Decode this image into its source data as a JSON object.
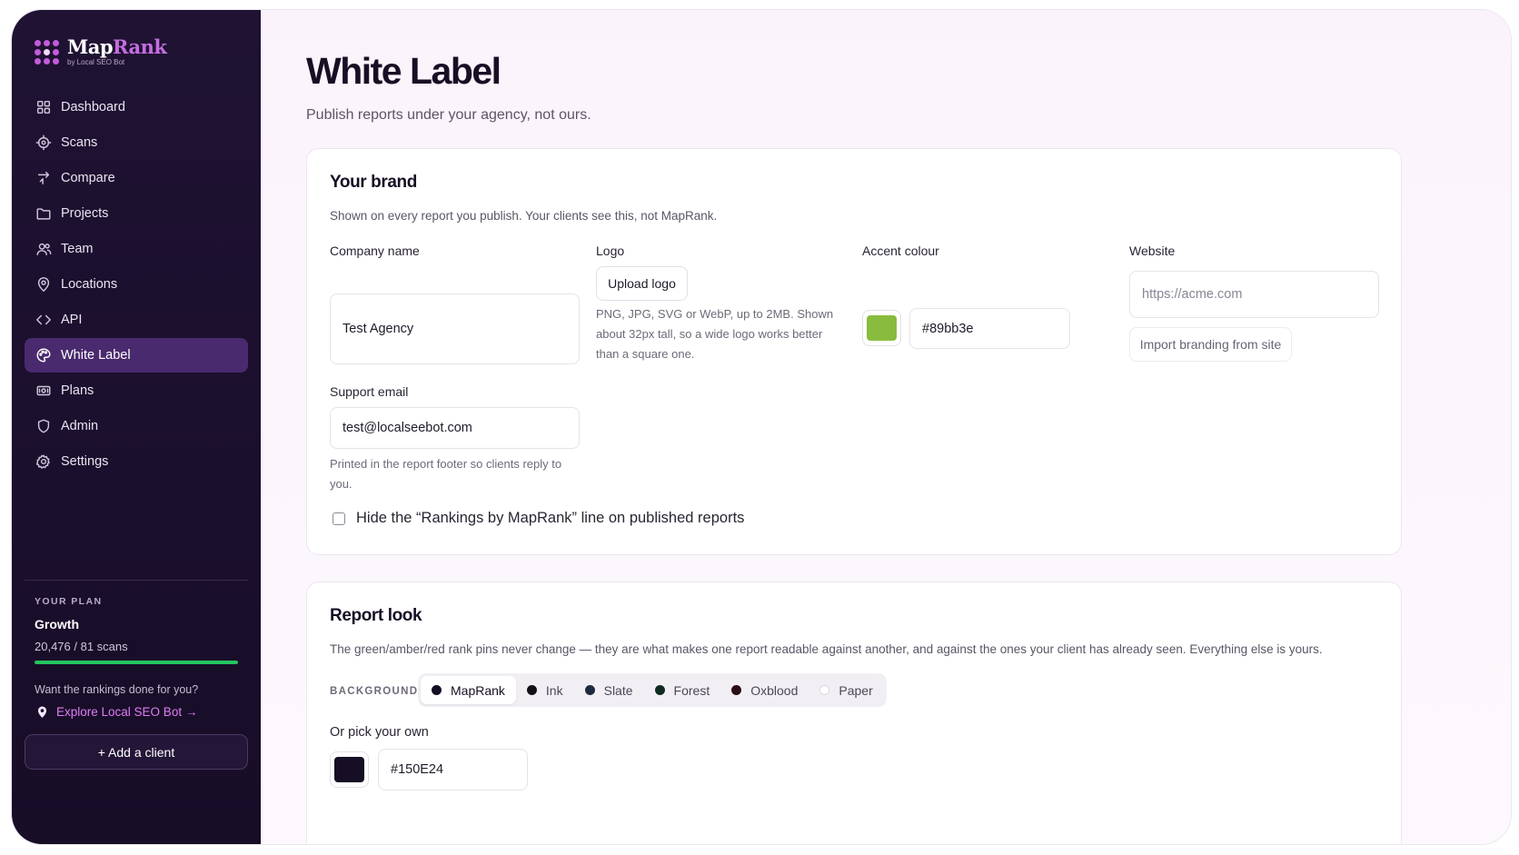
{
  "sidebar": {
    "brand": {
      "name_a": "Map",
      "name_b": "Rank",
      "sub": "by Local SEO Bot"
    },
    "items": [
      {
        "label": "Dashboard",
        "icon": "dashboard-icon"
      },
      {
        "label": "Scans",
        "icon": "scan-icon"
      },
      {
        "label": "Compare",
        "icon": "compare-icon"
      },
      {
        "label": "Projects",
        "icon": "folder-icon"
      },
      {
        "label": "Team",
        "icon": "team-icon"
      },
      {
        "label": "Locations",
        "icon": "location-pin-icon"
      },
      {
        "label": "API",
        "icon": "code-icon"
      },
      {
        "label": "White Label",
        "icon": "palette-icon",
        "active": true
      },
      {
        "label": "Plans",
        "icon": "plans-icon"
      },
      {
        "label": "Admin",
        "icon": "shield-icon"
      },
      {
        "label": "Settings",
        "icon": "gear-icon"
      }
    ],
    "plan": {
      "label": "YOUR PLAN",
      "name": "Growth",
      "usage": "20,476 / 81 scans",
      "usage_fraction": 1.0,
      "bar_color": "#22c55e"
    },
    "promo": {
      "text": "Want the rankings done for you?",
      "link": "Explore Local SEO Bot →"
    },
    "add_client": "+ Add a client"
  },
  "page": {
    "title": "White Label",
    "subtitle": "Publish reports under your agency, not ours."
  },
  "brand_card": {
    "title": "Your brand",
    "subtitle": "Shown on every report you publish. Your clients see this, not MapRank.",
    "company": {
      "label": "Company name",
      "value": "Test Agency"
    },
    "logo": {
      "label": "Logo",
      "button": "Upload logo",
      "help": "PNG, JPG, SVG or WebP, up to 2MB. Shown about 32px tall, so a wide logo works better than a square one."
    },
    "accent": {
      "label": "Accent colour",
      "value": "#89bb3e",
      "swatch_color": "#89bb3e"
    },
    "website": {
      "label": "Website",
      "placeholder": "https://acme.com",
      "import_button": "Import branding from site"
    },
    "support": {
      "label": "Support email",
      "value": "test@localseebot.com",
      "help": "Printed in the report footer so clients reply to you."
    },
    "hide_line": "Hide the “Rankings by MapRank” line on published reports"
  },
  "look_card": {
    "title": "Report look",
    "subtitle": "The green/amber/red rank pins never change — they are what makes one report readable against another, and against the ones your client has already seen. Everything else is yours.",
    "background_label": "BACKGROUND",
    "options": [
      {
        "label": "MapRank",
        "color": "#150e24",
        "active": true
      },
      {
        "label": "Ink",
        "color": "#111014"
      },
      {
        "label": "Slate",
        "color": "#1e2a3e"
      },
      {
        "label": "Forest",
        "color": "#102a20"
      },
      {
        "label": "Oxblood",
        "color": "#2a0e14"
      },
      {
        "label": "Paper",
        "color": "#ffffff"
      }
    ],
    "pick_label": "Or pick your own",
    "pick_value": "#150E24",
    "pick_swatch": "#150e24"
  }
}
